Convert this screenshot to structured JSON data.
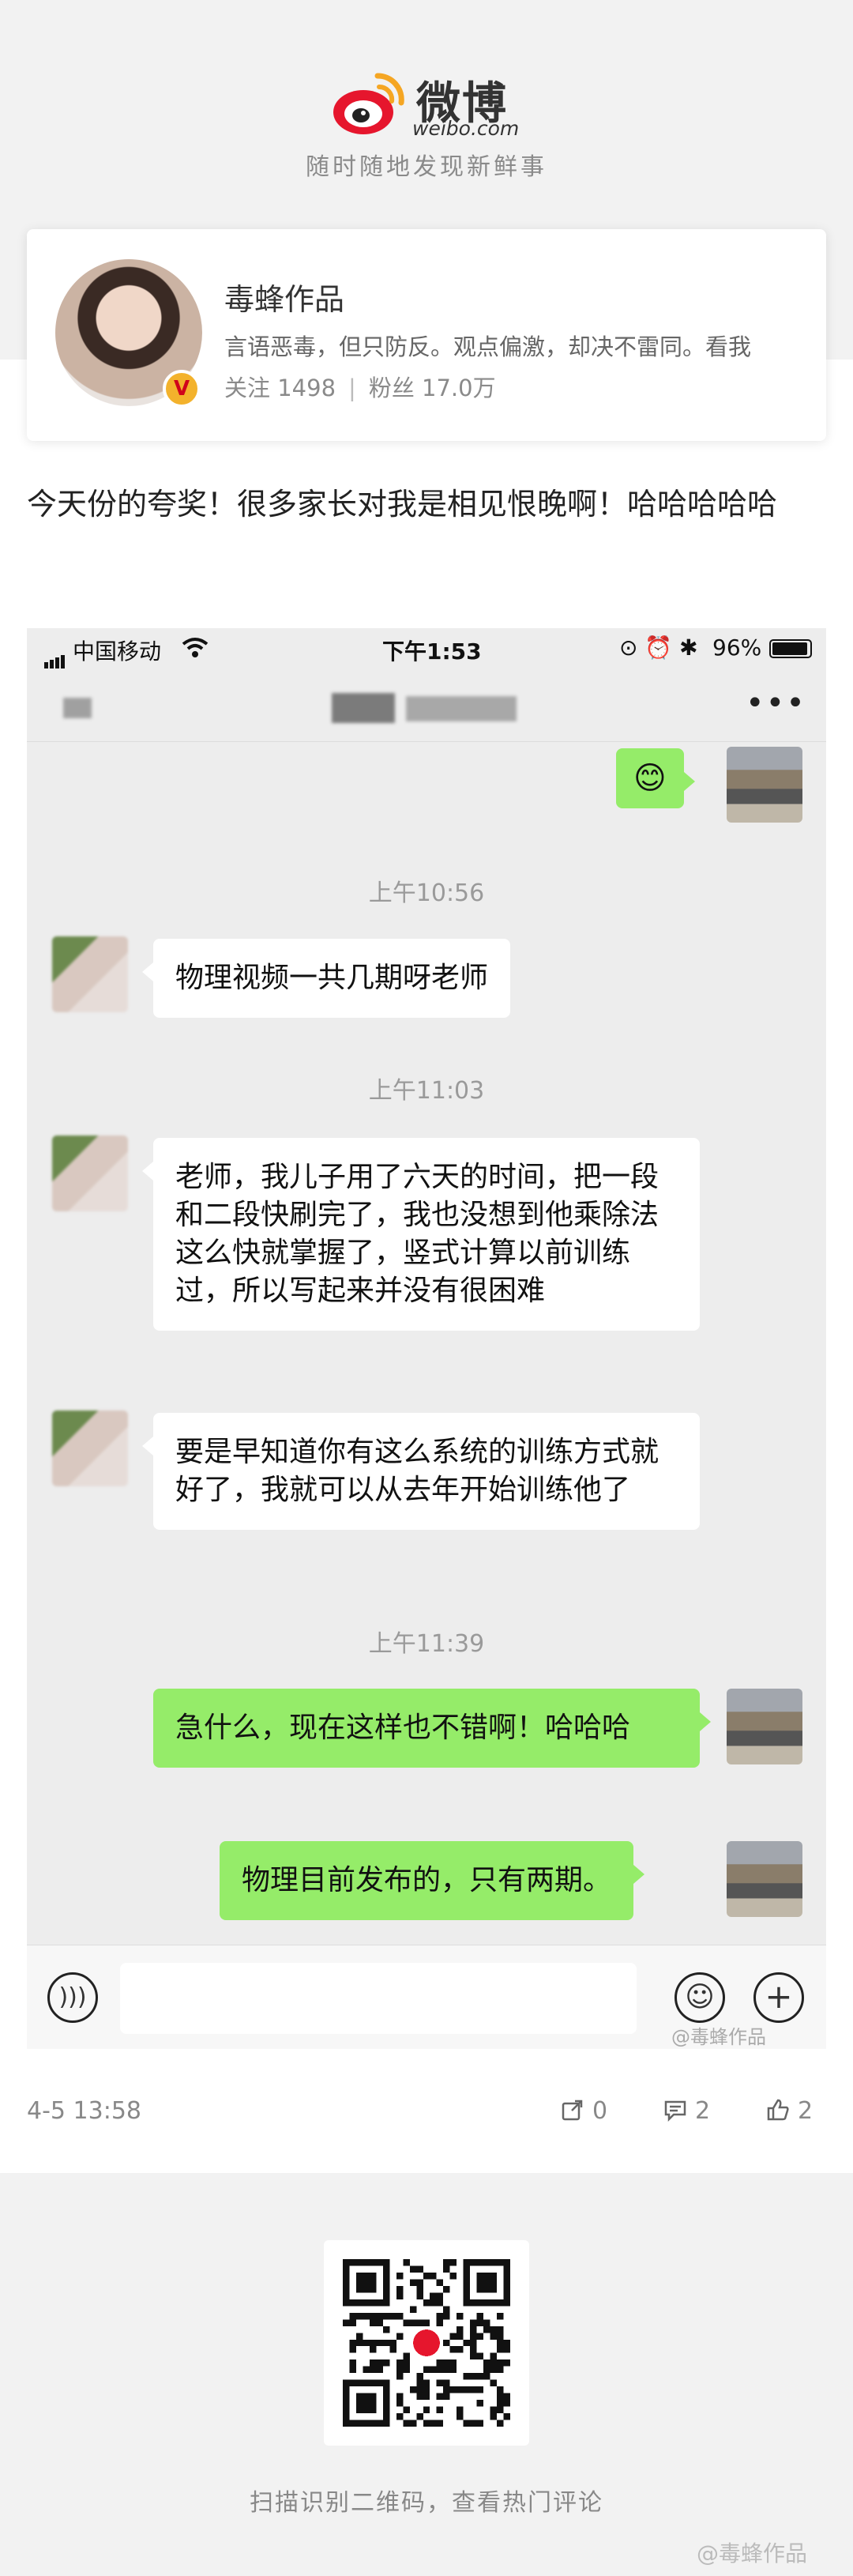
{
  "brand": {
    "name": "微博",
    "domain": "weibo.com",
    "slogan": "随时随地发现新鲜事"
  },
  "profile": {
    "name": "毒蜂作品",
    "bio": "言语恶毒，但只防反。观点偏激，却决不雷同。看我",
    "following_label": "关注 1498",
    "followers_label": "粉丝 17.0万",
    "verified_badge": "V"
  },
  "post": {
    "text": "今天份的夸奖！很多家长对我是相见恨晚啊！哈哈哈哈哈"
  },
  "chat": {
    "status_bar": {
      "carrier": "中国移动",
      "time": "下午1:53",
      "battery": "96%",
      "battery_level": 0.96
    },
    "messages": [
      {
        "from": "me",
        "text": "😊"
      },
      {
        "time": "上午10:56"
      },
      {
        "from": "other",
        "text": "物理视频一共几期呀老师"
      },
      {
        "time": "上午11:03"
      },
      {
        "from": "other",
        "text": "老师，我儿子用了六天的时间，把一段和二段快刷完了，我也没想到他乘除法这么快就掌握了，竖式计算以前训练过，所以写起来并没有很困难"
      },
      {
        "from": "other",
        "text": "要是早知道你有这么系统的训练方式就好了，我就可以从去年开始训练他了"
      },
      {
        "time": "上午11:39"
      },
      {
        "from": "me",
        "text": "急什么，现在这样也不错啊！哈哈哈"
      },
      {
        "from": "me",
        "text": "物理目前发布的，只有两期。"
      }
    ],
    "watermark": "@毒蜂作品"
  },
  "meta": {
    "date": "4-5 13:58",
    "reposts": "0",
    "comments": "2",
    "likes": "2"
  },
  "footer": {
    "qr_hint": "扫描识别二维码，查看热门评论",
    "corner_tag": "@毒蜂作品"
  },
  "colors": {
    "bubble_out": "#95ec69",
    "bubble_in": "#ffffff",
    "chat_bg": "#ededed",
    "weibo_red": "#e6162d"
  }
}
